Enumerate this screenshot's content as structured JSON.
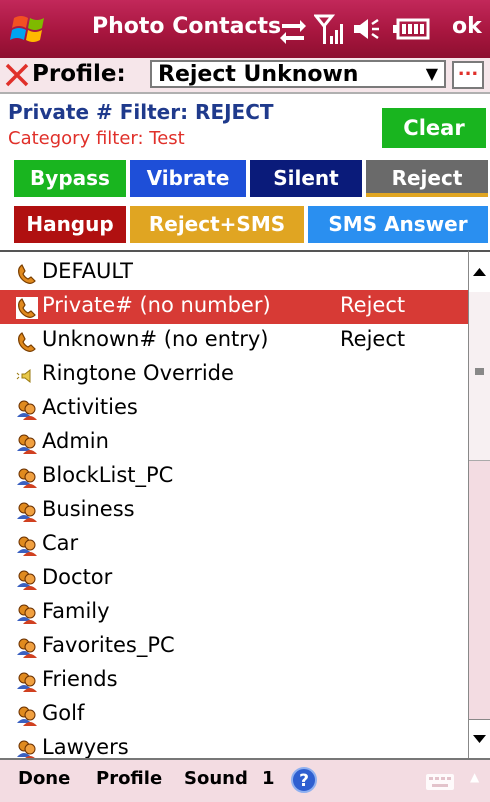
{
  "title_bar": {
    "app_title": "Photo Contacts",
    "ok_label": "ok"
  },
  "profile": {
    "label": "Profile:",
    "value": "Reject Unknown",
    "more_label": "..."
  },
  "filter": {
    "title": "Private # Filter: REJECT",
    "category": "Category filter: Test",
    "clear_label": "Clear"
  },
  "action_buttons": {
    "bypass": "Bypass",
    "vibrate": "Vibrate",
    "silent": "Silent",
    "reject": "Reject",
    "hangup": "Hangup",
    "reject_sms": "Reject+SMS",
    "sms_answer": "SMS Answer"
  },
  "list": {
    "items": [
      {
        "label": "DEFAULT",
        "status": "",
        "icon": "phone-icon"
      },
      {
        "label": "Private# (no number)",
        "status": "Reject",
        "icon": "phone-icon",
        "selected": true
      },
      {
        "label": "Unknown# (no entry)",
        "status": "Reject",
        "icon": "phone-icon"
      },
      {
        "label": "Ringtone Override",
        "status": "",
        "icon": "speaker-icon"
      },
      {
        "label": "Activities",
        "status": "",
        "icon": "contacts-icon"
      },
      {
        "label": "Admin",
        "status": "",
        "icon": "contacts-icon"
      },
      {
        "label": "BlockList_PC",
        "status": "",
        "icon": "contacts-icon"
      },
      {
        "label": "Business",
        "status": "",
        "icon": "contacts-icon"
      },
      {
        "label": "Car",
        "status": "",
        "icon": "contacts-icon"
      },
      {
        "label": "Doctor",
        "status": "",
        "icon": "contacts-icon"
      },
      {
        "label": "Family",
        "status": "",
        "icon": "contacts-icon"
      },
      {
        "label": "Favorites_PC",
        "status": "",
        "icon": "contacts-icon"
      },
      {
        "label": "Friends",
        "status": "",
        "icon": "contacts-icon"
      },
      {
        "label": "Golf",
        "status": "",
        "icon": "contacts-icon"
      },
      {
        "label": "Lawyers",
        "status": "",
        "icon": "contacts-icon"
      }
    ]
  },
  "bottom_bar": {
    "done": "Done",
    "profile": "Profile",
    "sound": "Sound",
    "sound_number": "1"
  },
  "colors": {
    "title_bar": "#a8163f",
    "selected_row": "#d73a35",
    "clear": "#19b51f",
    "bypass": "#19b51f",
    "vibrate": "#1e4fd8",
    "silent": "#0a1b7a",
    "reject": "#6a6a6a",
    "hangup": "#b01010",
    "reject_sms": "#e0a522",
    "sms_answer": "#2a8ff0"
  }
}
